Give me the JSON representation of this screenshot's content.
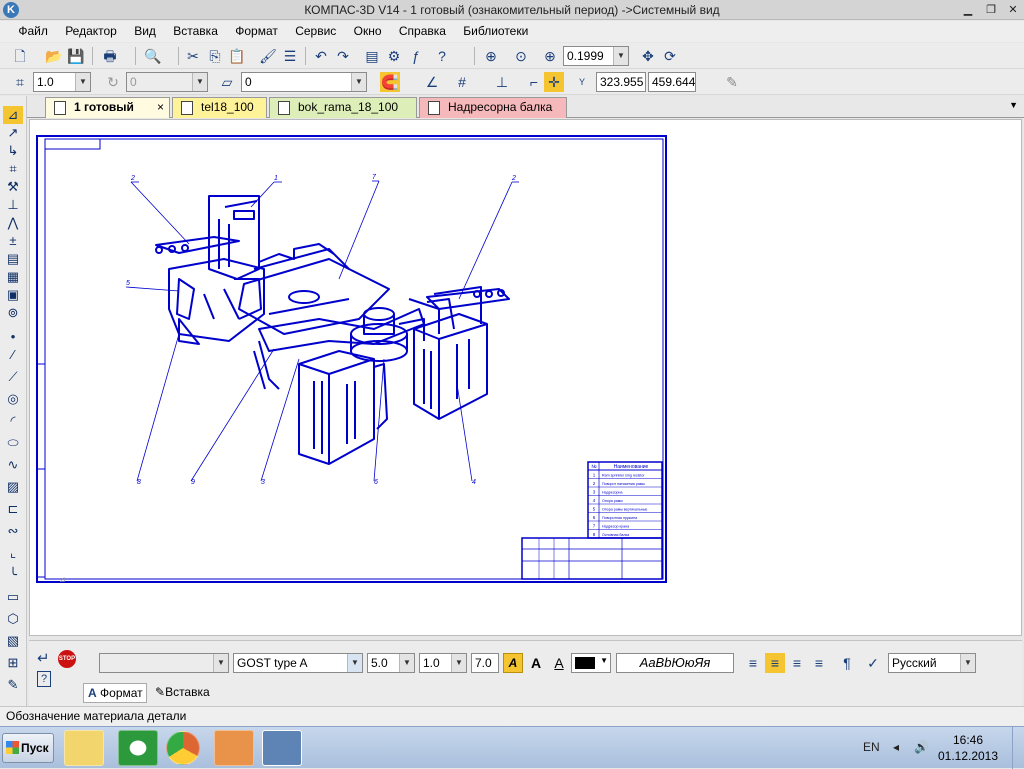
{
  "window": {
    "title": "КОМПАС-3D V14 - 1 готовый (ознакомительный период) ->Системный вид",
    "app_icon": "K"
  },
  "menu": [
    "Файл",
    "Редактор",
    "Вид",
    "Вставка",
    "Формат",
    "Сервис",
    "Окно",
    "Справка",
    "Библиотеки"
  ],
  "toolbar1": {
    "zoom_value": "0.1999"
  },
  "toolbar2": {
    "step_value": "1.0",
    "angle_value": "0",
    "layer_value": "0",
    "coord_y_label": "Y",
    "coord_x": "323.955",
    "coord_y": "459.6446"
  },
  "tabs": [
    {
      "label": "1 готовый",
      "color": "#fffbe1",
      "active": true,
      "close": "×"
    },
    {
      "label": "tel18_100",
      "color": "#fff39a",
      "active": false
    },
    {
      "label": "bok_rama_18_100",
      "color": "#ddeeb8",
      "active": false
    },
    {
      "label": "Надресорна балка",
      "color": "#f5b8bb",
      "active": false
    }
  ],
  "drawing": {
    "callouts": [
      "2",
      "1",
      "7",
      "2",
      "5",
      "8",
      "9",
      "3",
      "6",
      "4"
    ],
    "spec_rows": [
      {
        "num": "1",
        "name": "Ram sprinkler sing resistor"
      },
      {
        "num": "2",
        "name": "Поворот натяжения рамы"
      },
      {
        "num": "3",
        "name": "Надресорна"
      },
      {
        "num": "4",
        "name": "Опора рамы"
      },
      {
        "num": "5",
        "name": "Опора рамы вертикальные"
      },
      {
        "num": "6",
        "name": "Поворотная пружина"
      },
      {
        "num": "7",
        "name": "Надресор крана"
      },
      {
        "num": "8",
        "name": "Основная балка"
      }
    ],
    "spec_header": "Наименование"
  },
  "properties": {
    "font_name": "GOST type A",
    "height": "5.0",
    "narrowing": "1.0",
    "step": "7.0",
    "preview_text": "АаВbЮюЯя",
    "language": "Русский",
    "tab_format": "Формат",
    "tab_insert": "Вставка",
    "italic_label": "A",
    "bold_label": "A",
    "underline_label": "A",
    "stop_label": "STOP"
  },
  "status": {
    "text": "Обозначение материала детали"
  },
  "taskbar": {
    "start_label": "Пуск",
    "lang": "EN",
    "time": "16:46",
    "date": "01.12.2013"
  },
  "colors": {
    "drawing": "#0000cc",
    "accent": "#3a78b8"
  }
}
